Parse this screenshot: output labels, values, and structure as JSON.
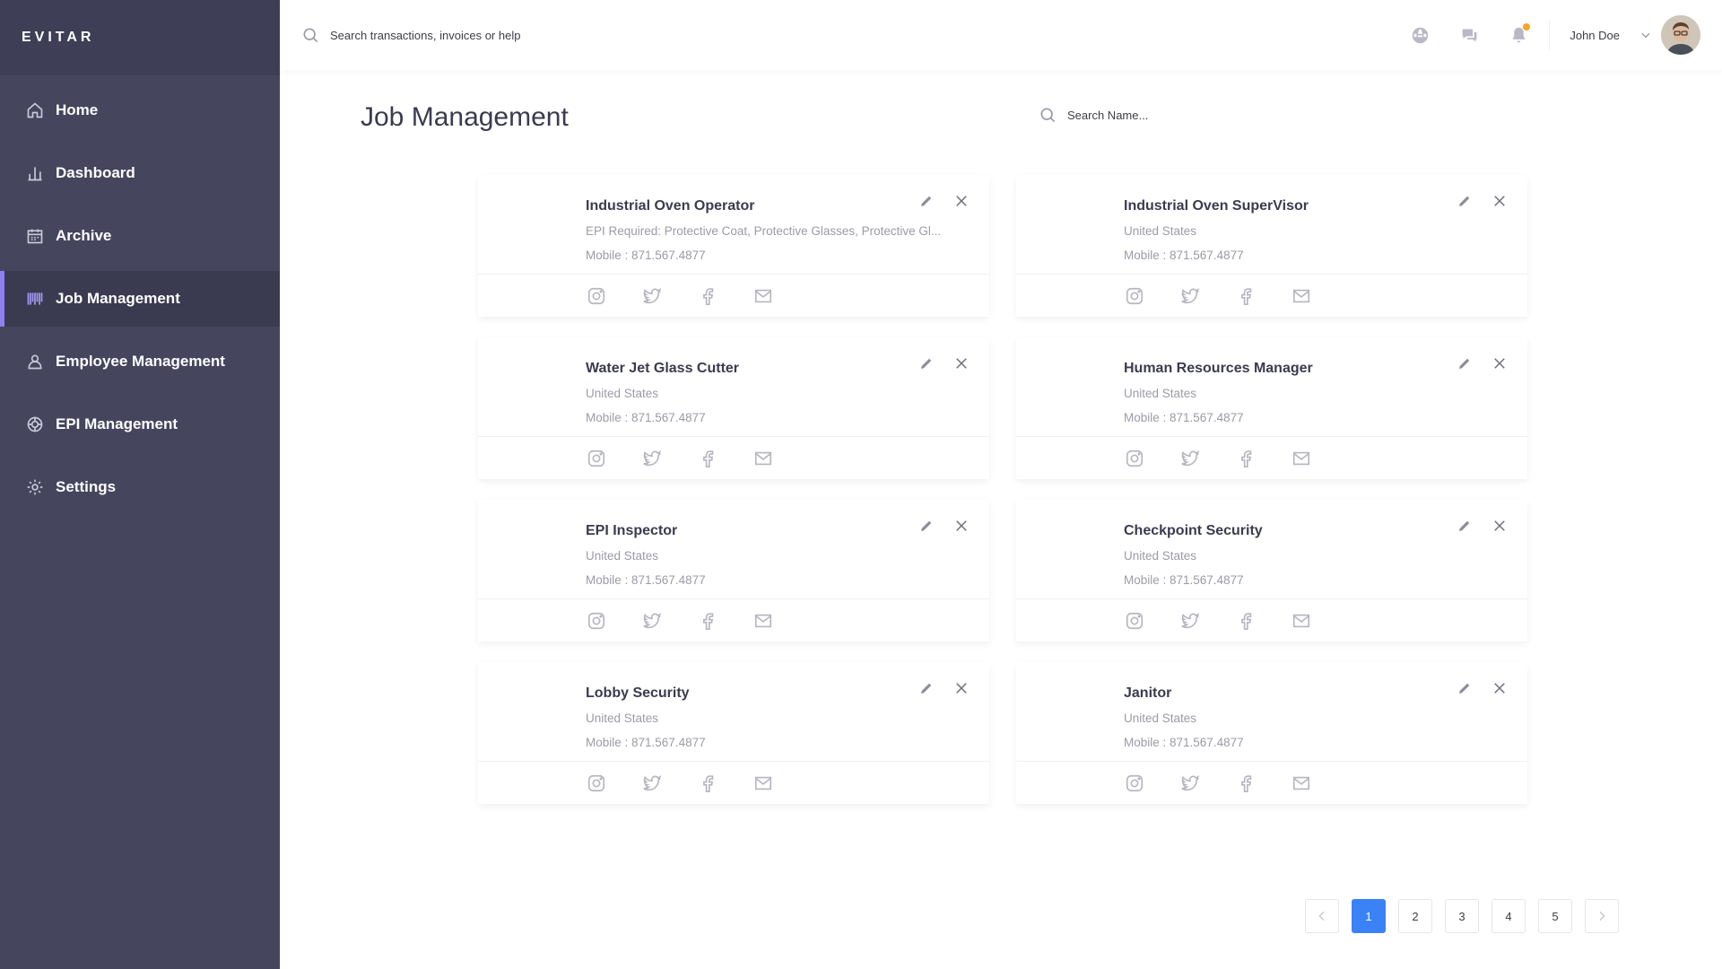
{
  "app": {
    "brand": "EVITAR"
  },
  "sidebar": {
    "items": [
      {
        "label": "Home",
        "icon": "home-icon"
      },
      {
        "label": "Dashboard",
        "icon": "bar-chart-icon"
      },
      {
        "label": "Archive",
        "icon": "calendar-icon"
      },
      {
        "label": "Job Management",
        "icon": "barcode-icon",
        "active": true
      },
      {
        "label": "Employee Management",
        "icon": "user-icon"
      },
      {
        "label": "EPI Management",
        "icon": "lifebuoy-icon"
      },
      {
        "label": "Settings",
        "icon": "gear-icon"
      }
    ]
  },
  "topbar": {
    "search_placeholder": "Search transactions, invoices or help",
    "user_name": "John Doe",
    "icons": [
      "globe-icon",
      "chat-icon",
      "bell-icon"
    ],
    "notification_dot_color": "#f5a623"
  },
  "main": {
    "title": "Job Management",
    "name_search_placeholder": "Search Name...",
    "cards": [
      {
        "title": "Industrial Oven Operator",
        "subtitle": "EPI Required: Protective Coat, Protective Glasses, Protective Gl...",
        "phone": "Mobile : 871.567.4877"
      },
      {
        "title": "Industrial Oven SuperVisor",
        "subtitle": "United States",
        "phone": "Mobile : 871.567.4877"
      },
      {
        "title": "Water Jet Glass Cutter",
        "subtitle": "United States",
        "phone": "Mobile : 871.567.4877"
      },
      {
        "title": "Human Resources Manager",
        "subtitle": "United States",
        "phone": "Mobile : 871.567.4877"
      },
      {
        "title": "EPI Inspector",
        "subtitle": "United States",
        "phone": "Mobile : 871.567.4877"
      },
      {
        "title": "Checkpoint Security",
        "subtitle": "United States",
        "phone": "Mobile : 871.567.4877"
      },
      {
        "title": "Lobby Security",
        "subtitle": "United States",
        "phone": "Mobile : 871.567.4877"
      },
      {
        "title": "Janitor",
        "subtitle": "United States",
        "phone": "Mobile : 871.567.4877"
      }
    ]
  },
  "pagination": {
    "pages": [
      "1",
      "2",
      "3",
      "4",
      "5"
    ],
    "current": "1",
    "active_color": "#3b82f6"
  }
}
